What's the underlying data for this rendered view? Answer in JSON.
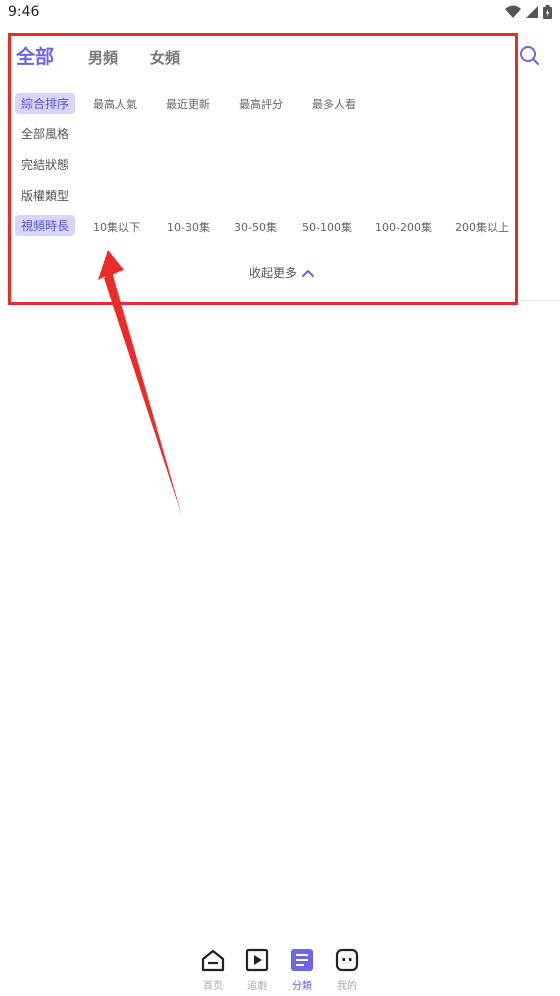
{
  "status": {
    "time": "9:46"
  },
  "tabs": [
    {
      "label": "全部"
    },
    {
      "label": "男頻"
    },
    {
      "label": "女頻"
    }
  ],
  "filters": {
    "sort": {
      "title": "綜合排序",
      "options": [
        "最高人氣",
        "最近更新",
        "最高評分",
        "最多人看"
      ]
    },
    "style": {
      "title": "全部風格"
    },
    "status": {
      "title": "完結狀態"
    },
    "type": {
      "title": "版權類型"
    },
    "duration": {
      "title": "視頻時長",
      "options": [
        "10集以下",
        "10-30集",
        "30-50集",
        "50-100集",
        "100-200集",
        "200集以上"
      ]
    }
  },
  "collapse_label": "收起更多",
  "accent_color": "#6e66e8",
  "bottom_nav": [
    {
      "label": "首页",
      "icon": "home-icon"
    },
    {
      "label": "追劇",
      "icon": "play-icon"
    },
    {
      "label": "分類",
      "icon": "category-icon"
    },
    {
      "label": "我的",
      "icon": "profile-icon"
    }
  ]
}
